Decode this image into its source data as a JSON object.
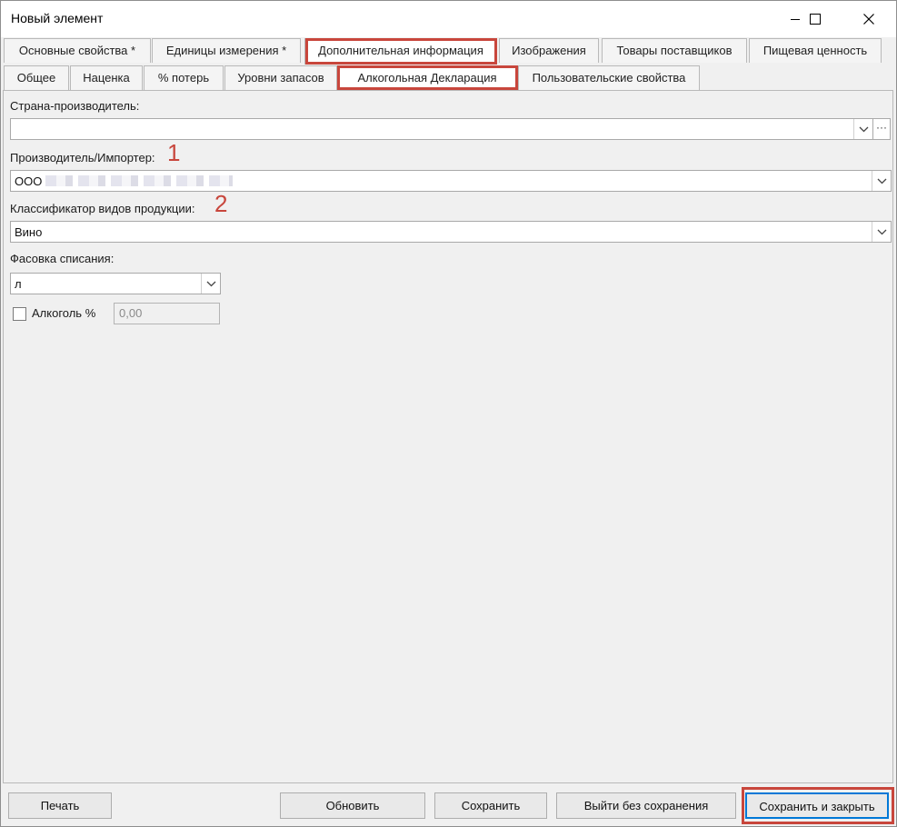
{
  "window": {
    "title": "Новый элемент"
  },
  "tabs_main": [
    {
      "label": "Основные свойства *"
    },
    {
      "label": "Единицы измерения *"
    },
    {
      "label": "Дополнительная информация"
    },
    {
      "label": "Изображения"
    },
    {
      "label": "Товары поставщиков"
    },
    {
      "label": "Пищевая ценность"
    }
  ],
  "tabs_sub": [
    {
      "label": "Общее"
    },
    {
      "label": "Наценка"
    },
    {
      "label": "% потерь"
    },
    {
      "label": "Уровни запасов"
    },
    {
      "label": "Алкогольная Декларация"
    },
    {
      "label": "Пользовательские свойства"
    }
  ],
  "form": {
    "country_label": "Страна-производитель:",
    "country_value": "",
    "ellipsis": "···",
    "producer_label": "Производитель/Импортер:",
    "producer_value": "ООО",
    "classifier_label": "Классификатор видов продукции:",
    "classifier_value": "Вино",
    "packing_label": "Фасовка списания:",
    "packing_value": "л",
    "alcohol_label": "Алкоголь %",
    "alcohol_value": "0,00"
  },
  "annotations": {
    "one": "1",
    "two": "2"
  },
  "buttons": {
    "print": "Печать",
    "refresh": "Обновить",
    "save": "Сохранить",
    "exit_no_save": "Выйти без сохранения",
    "save_close": "Сохранить и закрыть"
  },
  "colors": {
    "highlight": "#c8463c",
    "focus": "#0078d7"
  },
  "icons": [
    "minimize-icon",
    "maximize-icon",
    "close-icon",
    "chevron-down-icon",
    "ellipsis-icon",
    "checkbox-icon"
  ]
}
